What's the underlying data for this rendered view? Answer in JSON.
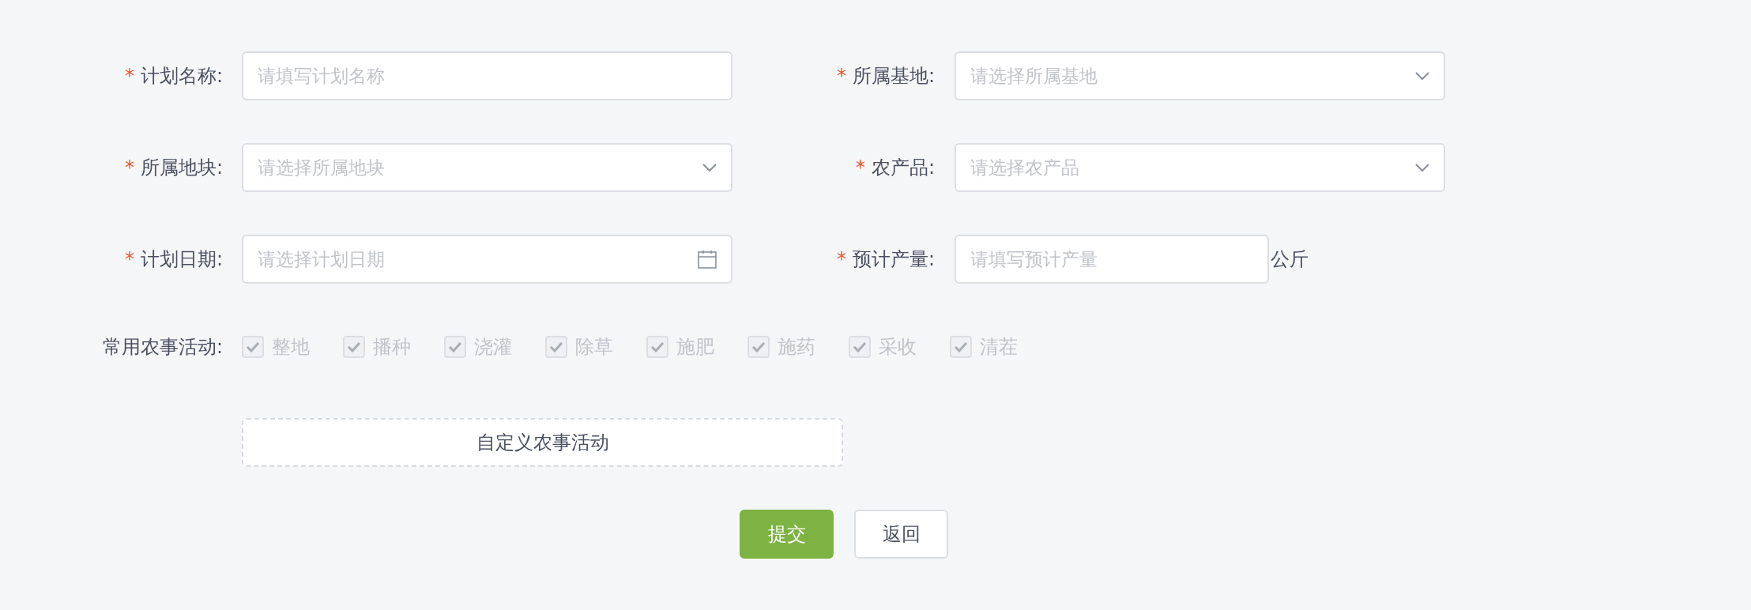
{
  "fields": [
    {
      "label": "计划名称:",
      "required": true,
      "kind": "text",
      "placeholder": "请填写计划名称"
    },
    {
      "label": "所属基地:",
      "required": true,
      "kind": "select",
      "placeholder": "请选择所属基地"
    },
    {
      "label": "所属地块:",
      "required": true,
      "kind": "select",
      "placeholder": "请选择所属地块"
    },
    {
      "label": "农产品:",
      "required": true,
      "kind": "select",
      "placeholder": "请选择农产品"
    },
    {
      "label": "计划日期:",
      "required": true,
      "kind": "date",
      "placeholder": "请选择计划日期"
    },
    {
      "label": "预计产量:",
      "required": true,
      "kind": "number",
      "placeholder": "请填写预计产量",
      "unit": "公斤"
    }
  ],
  "required_mark": "*",
  "activities": {
    "label": "常用农事活动:",
    "options": [
      {
        "label": "整地",
        "checked": true,
        "disabled": true
      },
      {
        "label": "播种",
        "checked": true,
        "disabled": true
      },
      {
        "label": "浇灌",
        "checked": true,
        "disabled": true
      },
      {
        "label": "除草",
        "checked": true,
        "disabled": true
      },
      {
        "label": "施肥",
        "checked": true,
        "disabled": true
      },
      {
        "label": "施药",
        "checked": true,
        "disabled": true
      },
      {
        "label": "采收",
        "checked": true,
        "disabled": true
      },
      {
        "label": "清茬",
        "checked": true,
        "disabled": true
      }
    ]
  },
  "custom_button": "自定义农事活动",
  "buttons": [
    {
      "label": "提交",
      "kind": "primary"
    },
    {
      "label": "返回",
      "kind": "default"
    }
  ]
}
